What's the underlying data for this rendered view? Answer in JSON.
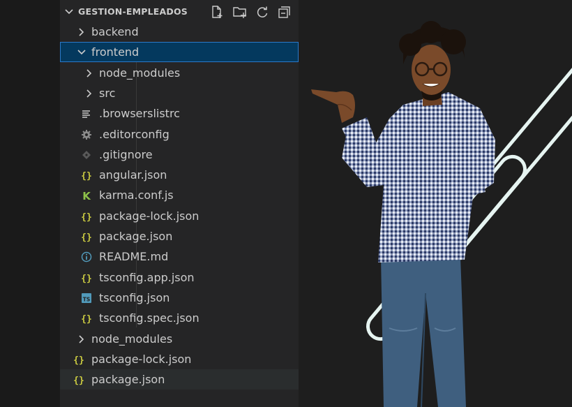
{
  "explorer": {
    "title": "GESTION-EMPLEADOS",
    "actions": [
      "new-file-icon",
      "new-folder-icon",
      "refresh-icon",
      "collapse-all-icon"
    ],
    "items": [
      {
        "label": "backend",
        "type": "folder",
        "expanded": false,
        "depth": 0
      },
      {
        "label": "frontend",
        "type": "folder",
        "expanded": true,
        "depth": 0,
        "selected": true
      },
      {
        "label": "node_modules",
        "type": "folder",
        "expanded": false,
        "depth": 1
      },
      {
        "label": "src",
        "type": "folder",
        "expanded": false,
        "depth": 1
      },
      {
        "label": ".browserslistrc",
        "type": "file",
        "icon": "lines-icon",
        "depth": 1
      },
      {
        "label": ".editorconfig",
        "type": "file",
        "icon": "gear-icon",
        "depth": 1
      },
      {
        "label": ".gitignore",
        "type": "file",
        "icon": "git-icon",
        "depth": 1
      },
      {
        "label": "angular.json",
        "type": "file",
        "icon": "json-icon",
        "depth": 1
      },
      {
        "label": "karma.conf.js",
        "type": "file",
        "icon": "karma-icon",
        "depth": 1
      },
      {
        "label": "package-lock.json",
        "type": "file",
        "icon": "json-icon",
        "depth": 1
      },
      {
        "label": "package.json",
        "type": "file",
        "icon": "json-icon",
        "depth": 1
      },
      {
        "label": "README.md",
        "type": "file",
        "icon": "info-icon",
        "depth": 1
      },
      {
        "label": "tsconfig.app.json",
        "type": "file",
        "icon": "json-icon",
        "depth": 1
      },
      {
        "label": "tsconfig.json",
        "type": "file",
        "icon": "ts-icon",
        "depth": 1
      },
      {
        "label": "tsconfig.spec.json",
        "type": "file",
        "icon": "json-icon",
        "depth": 1
      },
      {
        "label": "node_modules",
        "type": "folder",
        "expanded": false,
        "depth": 0
      },
      {
        "label": "package-lock.json",
        "type": "file",
        "icon": "json-icon",
        "depth": 0
      },
      {
        "label": "package.json",
        "type": "file",
        "icon": "json-icon",
        "depth": 0,
        "hovered": true
      }
    ]
  },
  "colors": {
    "background": "#1e1e1e",
    "sidebar": "#252526",
    "selection": "#04395e",
    "selection_border": "#2b79c9",
    "json_icon": "#cbcb41",
    "karma_icon": "#8dc149",
    "info_icon": "#519aba",
    "ts_icon": "#519aba",
    "decor_ring": "#e6f4f1"
  },
  "illustration": {
    "subject": "person-pointing-illustration",
    "decor": "outlined-ring-decor"
  }
}
